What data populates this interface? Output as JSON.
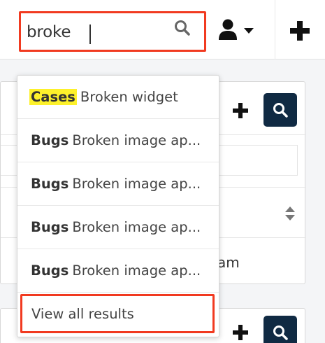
{
  "search": {
    "value": "broke",
    "placeholder": ""
  },
  "icons": {
    "search": "search-icon",
    "user": "user-icon",
    "caret": "caret-down-icon",
    "plus": "plus-icon",
    "sort": "sort-icon"
  },
  "colors": {
    "highlight_border": "#f13a20",
    "match_highlight": "#fdf12b",
    "dark_button": "#102a43"
  },
  "results": [
    {
      "module": "Cases",
      "title": "Broken widget",
      "highlighted": true
    },
    {
      "module": "Bugs",
      "title": "Broken image ap...",
      "highlighted": false
    },
    {
      "module": "Bugs",
      "title": "Broken image ap...",
      "highlighted": false
    },
    {
      "module": "Bugs",
      "title": "Broken image ap...",
      "highlighted": false
    },
    {
      "module": "Bugs",
      "title": "Broken image ap...",
      "highlighted": false
    }
  ],
  "view_all_label": "View all results",
  "background": {
    "dashlet_text": "am"
  }
}
